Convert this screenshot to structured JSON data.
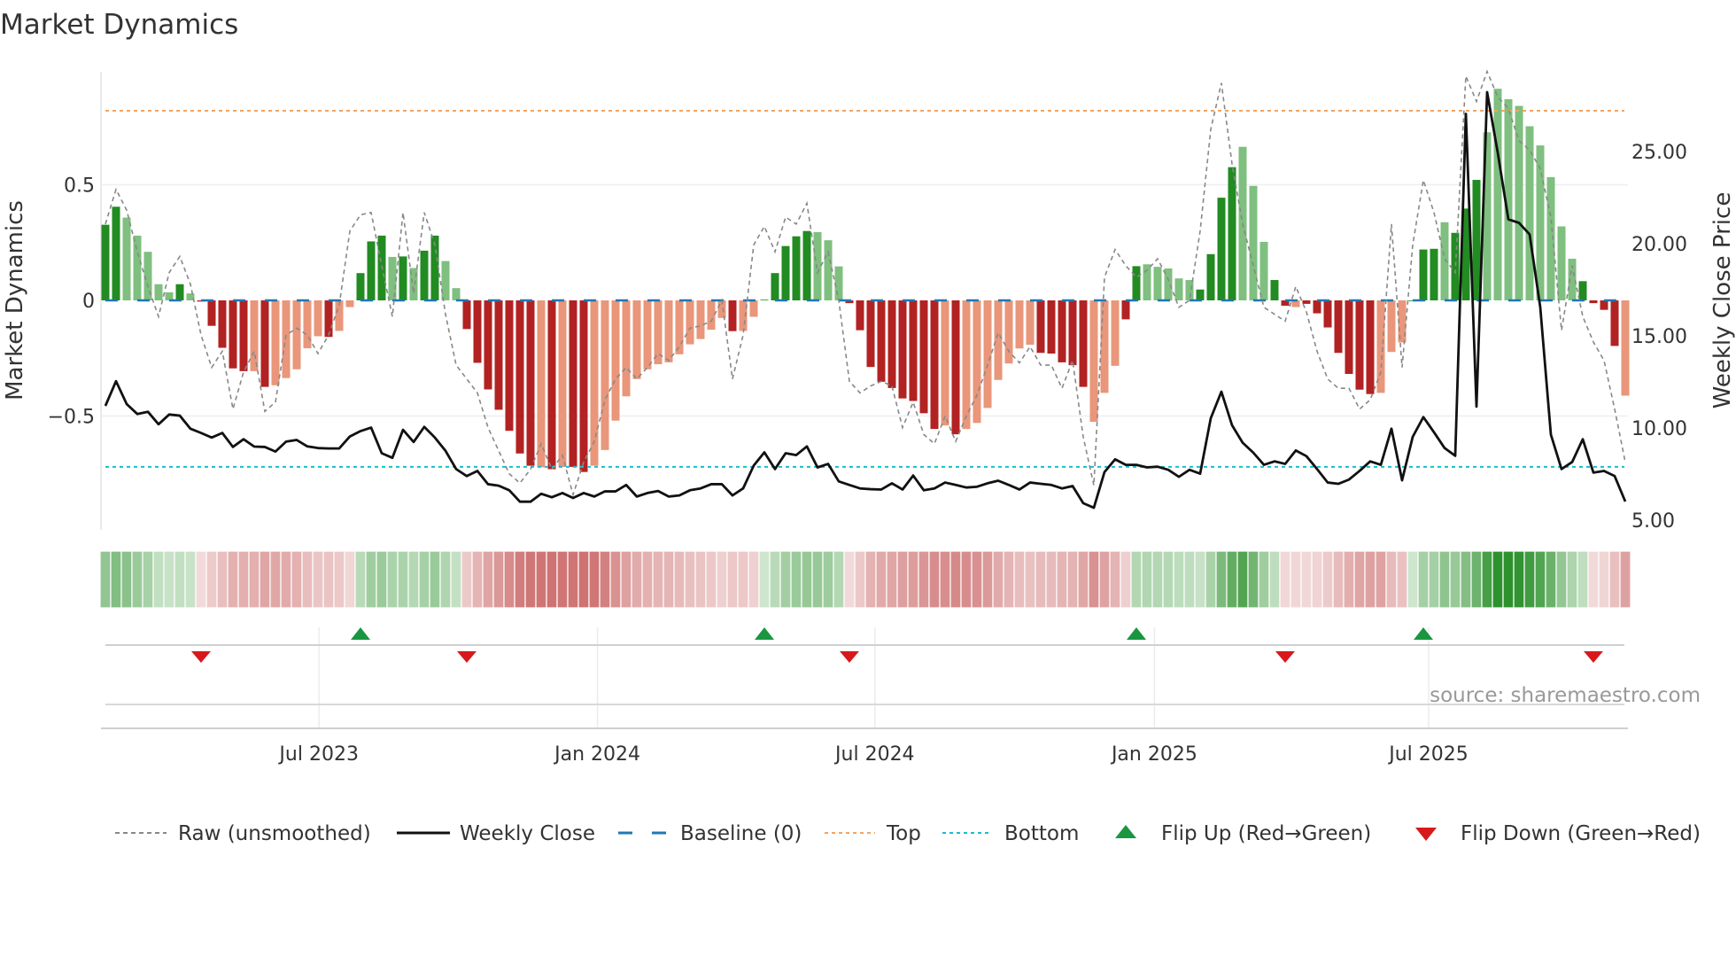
{
  "chart_data": {
    "type": "bar",
    "title": "Market Dynamics",
    "ylabel": "Market Dynamics",
    "y2label": "Weekly Close Price",
    "ylim": [
      -0.95,
      1.0
    ],
    "y2lim": [
      4.5,
      29.0
    ],
    "yticks": [
      {
        "value": 0.5,
        "label": "0.5"
      },
      {
        "value": 0,
        "label": "0"
      },
      {
        "value": -0.5,
        "label": "−0.5"
      }
    ],
    "y2ticks": [
      {
        "value": 25,
        "label": "25.00"
      },
      {
        "value": 20,
        "label": "20.00"
      },
      {
        "value": 15,
        "label": "15.00"
      },
      {
        "value": 10,
        "label": "10.00"
      },
      {
        "value": 5,
        "label": "5.00"
      }
    ],
    "xticks": [
      {
        "week": 20.1,
        "label": "Jul 2023"
      },
      {
        "week": 46.3,
        "label": "Jan 2024"
      },
      {
        "week": 72.4,
        "label": "Jul 2024"
      },
      {
        "week": 98.7,
        "label": "Jan 2025"
      },
      {
        "week": 124.5,
        "label": "Jul 2025"
      }
    ],
    "top": 0.82,
    "bottom": -0.72,
    "baseline": 0,
    "values": [
      0.327,
      0.405,
      0.358,
      0.28,
      0.21,
      0.07,
      0.035,
      0.07,
      0.03,
      -0.005,
      -0.11,
      -0.205,
      -0.294,
      -0.306,
      -0.306,
      -0.374,
      -0.367,
      -0.336,
      -0.298,
      -0.207,
      -0.155,
      -0.158,
      -0.132,
      -0.029,
      0.118,
      0.255,
      0.28,
      0.188,
      0.19,
      0.14,
      0.215,
      0.28,
      0.17,
      0.053,
      -0.124,
      -0.27,
      -0.385,
      -0.473,
      -0.564,
      -0.662,
      -0.715,
      -0.722,
      -0.73,
      -0.72,
      -0.72,
      -0.742,
      -0.715,
      -0.647,
      -0.52,
      -0.415,
      -0.34,
      -0.298,
      -0.276,
      -0.268,
      -0.233,
      -0.19,
      -0.167,
      -0.127,
      -0.076,
      -0.133,
      -0.132,
      -0.071,
      0.003,
      0.118,
      0.235,
      0.277,
      0.3,
      0.295,
      0.26,
      0.147,
      -0.012,
      -0.129,
      -0.288,
      -0.352,
      -0.379,
      -0.424,
      -0.435,
      -0.488,
      -0.556,
      -0.541,
      -0.579,
      -0.556,
      -0.53,
      -0.465,
      -0.344,
      -0.273,
      -0.208,
      -0.192,
      -0.227,
      -0.23,
      -0.268,
      -0.28,
      -0.374,
      -0.525,
      -0.4,
      -0.283,
      -0.082,
      0.148,
      0.156,
      0.145,
      0.138,
      0.095,
      0.088,
      0.047,
      0.2,
      0.444,
      0.576,
      0.664,
      0.495,
      0.253,
      0.088,
      -0.023,
      -0.029,
      -0.015,
      -0.056,
      -0.117,
      -0.227,
      -0.318,
      -0.386,
      -0.405,
      -0.4,
      -0.223,
      -0.182,
      0.0,
      0.22,
      0.223,
      0.338,
      0.292,
      0.397,
      0.521,
      0.727,
      0.915,
      0.87,
      0.841,
      0.753,
      0.67,
      0.533,
      0.32,
      0.18,
      0.083,
      -0.012,
      -0.041,
      -0.197,
      -0.412
    ],
    "shade": "ddllllldldddddldllllldlldddldlddlldddddddldlddllllllllllllldlldddddllldddddddddldllllllldddddlllddlllllddddlllddldddddddllldddldddllllllllldddd",
    "raw": [
      0.33,
      0.48,
      0.39,
      0.21,
      0.06,
      -0.07,
      0.12,
      0.19,
      0.07,
      -0.15,
      -0.29,
      -0.22,
      -0.47,
      -0.31,
      -0.22,
      -0.48,
      -0.44,
      -0.15,
      -0.12,
      -0.15,
      -0.23,
      -0.15,
      -0.02,
      0.3,
      0.37,
      0.38,
      0.15,
      -0.07,
      0.38,
      0.03,
      0.38,
      0.24,
      -0.06,
      -0.28,
      -0.34,
      -0.4,
      -0.55,
      -0.65,
      -0.75,
      -0.79,
      -0.73,
      -0.62,
      -0.73,
      -0.67,
      -0.84,
      -0.7,
      -0.61,
      -0.43,
      -0.34,
      -0.29,
      -0.34,
      -0.29,
      -0.23,
      -0.26,
      -0.2,
      -0.12,
      -0.11,
      -0.09,
      0.0,
      -0.34,
      -0.15,
      0.24,
      0.32,
      0.21,
      0.36,
      0.33,
      0.42,
      0.12,
      0.21,
      0.0,
      -0.35,
      -0.4,
      -0.37,
      -0.35,
      -0.37,
      -0.55,
      -0.44,
      -0.58,
      -0.62,
      -0.5,
      -0.61,
      -0.5,
      -0.41,
      -0.28,
      -0.14,
      -0.22,
      -0.27,
      -0.2,
      -0.28,
      -0.28,
      -0.38,
      -0.26,
      -0.59,
      -0.8,
      0.1,
      0.22,
      0.15,
      0.1,
      0.13,
      0.18,
      0.09,
      -0.03,
      0.0,
      0.3,
      0.74,
      0.94,
      0.59,
      0.33,
      0.15,
      -0.03,
      -0.06,
      -0.09,
      0.06,
      -0.05,
      -0.22,
      -0.34,
      -0.38,
      -0.38,
      -0.47,
      -0.43,
      -0.31,
      0.33,
      -0.29,
      0.24,
      0.52,
      0.38,
      0.18,
      0.12,
      0.97,
      0.86,
      0.99,
      0.88,
      0.83,
      0.69,
      0.65,
      0.57,
      0.36,
      -0.13,
      0.15,
      -0.07,
      -0.18,
      -0.26,
      -0.47,
      -0.7
    ],
    "close": [
      11.2,
      12.54,
      11.3,
      10.76,
      10.88,
      10.2,
      10.73,
      10.67,
      9.96,
      9.73,
      9.48,
      9.73,
      8.97,
      9.39,
      8.99,
      8.97,
      8.72,
      9.26,
      9.35,
      9.0,
      8.91,
      8.89,
      8.89,
      9.54,
      9.83,
      10.02,
      8.63,
      8.38,
      9.9,
      9.24,
      10.06,
      9.48,
      8.76,
      7.77,
      7.39,
      7.67,
      6.95,
      6.87,
      6.62,
      6.0,
      6.0,
      6.43,
      6.24,
      6.47,
      6.2,
      6.47,
      6.28,
      6.56,
      6.56,
      6.91,
      6.28,
      6.47,
      6.58,
      6.28,
      6.34,
      6.62,
      6.72,
      6.95,
      6.95,
      6.34,
      6.72,
      7.96,
      8.68,
      7.77,
      8.63,
      8.53,
      9.0,
      7.86,
      8.05,
      7.1,
      6.91,
      6.72,
      6.68,
      6.66,
      7.0,
      6.66,
      7.42,
      6.62,
      6.72,
      7.04,
      6.91,
      6.77,
      6.81,
      7.0,
      7.14,
      6.91,
      6.66,
      7.04,
      6.97,
      6.91,
      6.72,
      6.85,
      5.92,
      5.67,
      7.61,
      8.3,
      8.0,
      8.0,
      7.86,
      7.9,
      7.73,
      7.35,
      7.73,
      7.52,
      10.53,
      11.97,
      10.15,
      9.2,
      8.66,
      8.0,
      8.19,
      8.05,
      8.78,
      8.47,
      7.77,
      7.04,
      6.97,
      7.2,
      7.67,
      8.19,
      8.0,
      9.96,
      7.16,
      9.52,
      10.59,
      9.77,
      8.91,
      8.49,
      27.04,
      11.16,
      28.22,
      24.94,
      21.32,
      21.13,
      20.5,
      16.55,
      9.64,
      7.77,
      8.15,
      9.39,
      7.58,
      7.67,
      7.39,
      6.01
    ],
    "flip_up_weeks": [
      24,
      62,
      97,
      124
    ],
    "flip_down_weeks": [
      9,
      34,
      70,
      111,
      140
    ],
    "legend": {
      "placement": "bottom",
      "items": [
        {
          "key": "raw",
          "label": "Raw (unsmoothed)"
        },
        {
          "key": "close",
          "label": "Weekly Close"
        },
        {
          "key": "baseline",
          "label": "Baseline (0)"
        },
        {
          "key": "top",
          "label": "Top"
        },
        {
          "key": "bottom",
          "label": "Bottom"
        },
        {
          "key": "flip_up",
          "label": "Flip Up (Red→Green)"
        },
        {
          "key": "flip_down",
          "label": "Flip Down (Green→Red)"
        }
      ]
    },
    "source": "source: sharemaestro.com",
    "colors": {
      "green_strong": "#228b22",
      "green_weak": "#7fbf7f",
      "red_strong": "#b22222",
      "red_weak": "#e9967a",
      "baseline": "#1f77b4",
      "top": "#f4a460",
      "bottom": "#17becf",
      "raw": "#888888",
      "close": "#111111",
      "flip_up": "#1a9641",
      "flip_down": "#d7191c"
    }
  }
}
